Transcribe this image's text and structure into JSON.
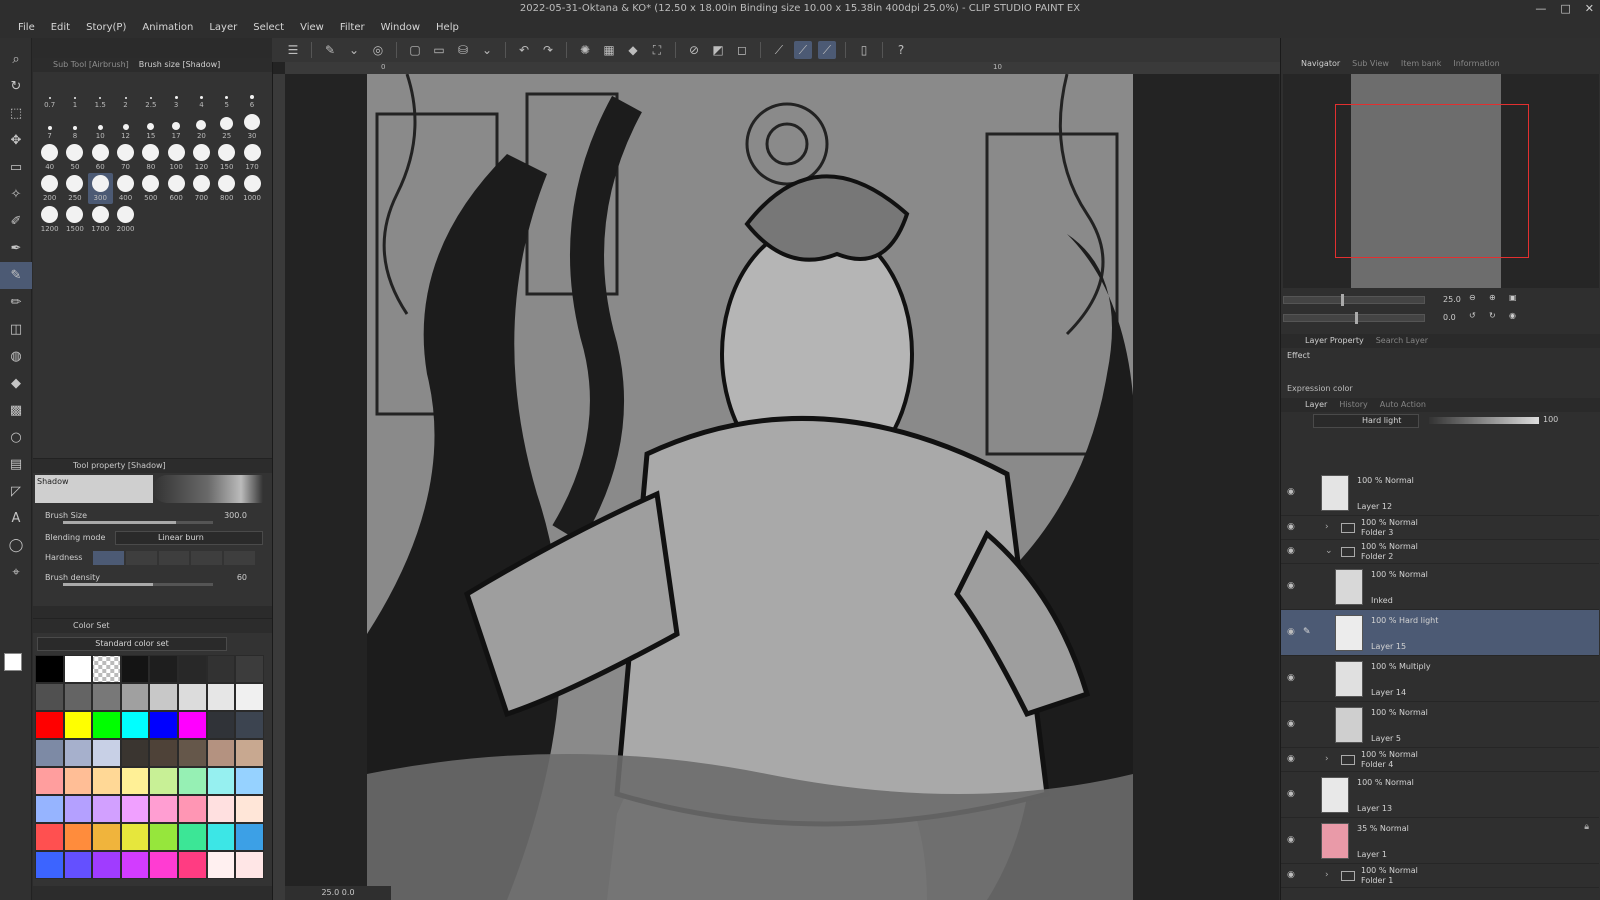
{
  "title": "2022-05-31-Oktana & KO* (12.50 x 18.00in Binding size 10.00 x 15.38in 400dpi 25.0%) - CLIP STUDIO PAINT EX",
  "window_controls": [
    "—",
    "□",
    "✕"
  ],
  "menu": [
    "File",
    "Edit",
    "Story(P)",
    "Animation",
    "Layer",
    "Select",
    "View",
    "Filter",
    "Window",
    "Help"
  ],
  "subtool": {
    "tabs": [
      "Sub Tool [Airbrush]",
      "Brush size [Shadow]"
    ],
    "brush_rows": [
      [
        {
          "l": "0.7",
          "s": 2
        },
        {
          "l": "1",
          "s": 2
        },
        {
          "l": "1.5",
          "s": 2
        },
        {
          "l": "2",
          "s": 2
        },
        {
          "l": "2.5",
          "s": 2
        },
        {
          "l": "3",
          "s": 3
        },
        {
          "l": "4",
          "s": 3
        },
        {
          "l": "5",
          "s": 3
        },
        {
          "l": "6",
          "s": 4
        }
      ],
      [
        {
          "l": "7",
          "s": 4
        },
        {
          "l": "8",
          "s": 4
        },
        {
          "l": "10",
          "s": 5
        },
        {
          "l": "12",
          "s": 6
        },
        {
          "l": "15",
          "s": 7
        },
        {
          "l": "17",
          "s": 8
        },
        {
          "l": "20",
          "s": 10
        },
        {
          "l": "25",
          "s": 13
        },
        {
          "l": "30",
          "s": 16
        }
      ],
      [
        {
          "l": "40",
          "s": 17
        },
        {
          "l": "50",
          "s": 17
        },
        {
          "l": "60",
          "s": 17
        },
        {
          "l": "70",
          "s": 17
        },
        {
          "l": "80",
          "s": 17
        },
        {
          "l": "100",
          "s": 17
        },
        {
          "l": "120",
          "s": 17
        },
        {
          "l": "150",
          "s": 17
        },
        {
          "l": "170",
          "s": 17
        }
      ],
      [
        {
          "l": "200",
          "s": 17
        },
        {
          "l": "250",
          "s": 17
        },
        {
          "l": "300",
          "s": 17,
          "sel": true
        },
        {
          "l": "400",
          "s": 17
        },
        {
          "l": "500",
          "s": 17
        },
        {
          "l": "600",
          "s": 17
        },
        {
          "l": "700",
          "s": 17
        },
        {
          "l": "800",
          "s": 17
        },
        {
          "l": "1000",
          "s": 17
        }
      ],
      [
        {
          "l": "1200",
          "s": 17
        },
        {
          "l": "1500",
          "s": 17
        },
        {
          "l": "1700",
          "s": 17
        },
        {
          "l": "2000",
          "s": 17
        }
      ]
    ]
  },
  "toolprop": {
    "header": "Tool property [Shadow]",
    "brush_name": "Shadow",
    "brush_size_label": "Brush Size",
    "brush_size_value": "300.0",
    "brush_size_level": 0.75,
    "blending_label": "Blending mode",
    "blending_value": "Linear burn",
    "hardness_label": "Hardness",
    "density_label": "Brush density",
    "density_value": "60",
    "density_level": 0.6
  },
  "colorset": {
    "header": "Color Set",
    "select": "Standard color set",
    "swatches": [
      "#000000",
      "#ffffff",
      "checker",
      "#141414",
      "#1e1e1e",
      "#282828",
      "#323232",
      "#3c3c3c",
      "#505050",
      "#646464",
      "#787878",
      "#a0a0a0",
      "#c8c8c8",
      "#dcdcdc",
      "#e6e6e6",
      "#f0f0f0",
      "#ff0000",
      "#ffff00",
      "#00ff00",
      "#00ffff",
      "#0000ff",
      "#ff00ff",
      "#303338",
      "#3c4450",
      "#7d8aa5",
      "#a6b0cc",
      "#c8d0e6",
      "#3a3530",
      "#4e4238",
      "#65574a",
      "#b49280",
      "#c8a890",
      "#ff9e9e",
      "#ffbe96",
      "#ffd896",
      "#fff096",
      "#c8f096",
      "#96f0b4",
      "#96f0f0",
      "#96d2ff",
      "#96b4ff",
      "#b4a0ff",
      "#d2a0ff",
      "#f0a0ff",
      "#ff9ed2",
      "#ff96b4",
      "#ffe0e0",
      "#ffe6d8",
      "#ff5050",
      "#ff8c3c",
      "#f0b43c",
      "#e6e63c",
      "#96e63c",
      "#3ce696",
      "#3ce6e6",
      "#3ca0e6",
      "#3c64ff",
      "#6450ff",
      "#a03cff",
      "#d23cff",
      "#ff3cd2",
      "#ff3c82",
      "#fff0f0",
      "#ffe6e6"
    ]
  },
  "canvas": {
    "ruler_marks": [
      "0",
      "10"
    ],
    "zoom_status": "25.0   0.0"
  },
  "navigator": {
    "tabs": [
      "Navigator",
      "Sub View",
      "Item bank",
      "Information"
    ],
    "zoom": "25.0",
    "rotate": "0.0"
  },
  "layerprop": {
    "tabs": [
      "Layer Property",
      "Search Layer"
    ],
    "effect": "Effect",
    "expression": "Expression color"
  },
  "layers_panel": {
    "tabs": [
      "Layer",
      "History",
      "Auto Action"
    ],
    "blend": "Hard light",
    "opacity": "100",
    "layers": [
      {
        "line1": "100 % Normal",
        "line2": "Layer 12",
        "type": "layer",
        "indent": 0,
        "thumb": "#e4e4e4"
      },
      {
        "line1": "100 % Normal",
        "line2": "Folder 3",
        "type": "folder",
        "indent": 0,
        "open": false
      },
      {
        "line1": "100 % Normal",
        "line2": "Folder 2",
        "type": "folder",
        "indent": 0,
        "open": true
      },
      {
        "line1": "100 % Normal",
        "line2": "Inked",
        "type": "layer",
        "indent": 1,
        "thumb": "#d8d8d8"
      },
      {
        "line1": "100 % Hard light",
        "line2": "Layer 15",
        "type": "layer",
        "indent": 1,
        "thumb": "#ececec",
        "selected": true
      },
      {
        "line1": "100 % Multiply",
        "line2": "Layer 14",
        "type": "layer",
        "indent": 1,
        "thumb": "#e0e0e0"
      },
      {
        "line1": "100 % Normal",
        "line2": "Layer 5",
        "type": "layer",
        "indent": 1,
        "thumb": "#cfcfcf"
      },
      {
        "line1": "100 % Normal",
        "line2": "Folder 4",
        "type": "folder",
        "indent": 0,
        "open": false
      },
      {
        "line1": "100 % Normal",
        "line2": "Layer 13",
        "type": "layer",
        "indent": 0,
        "thumb": "#e8e8e8"
      },
      {
        "line1": "35 % Normal",
        "line2": "Layer 1",
        "type": "layer",
        "indent": 0,
        "thumb": "#e99aa8",
        "locked": true
      },
      {
        "line1": "100 % Normal",
        "line2": "Folder 1",
        "type": "folder",
        "indent": 0,
        "open": false
      }
    ]
  }
}
